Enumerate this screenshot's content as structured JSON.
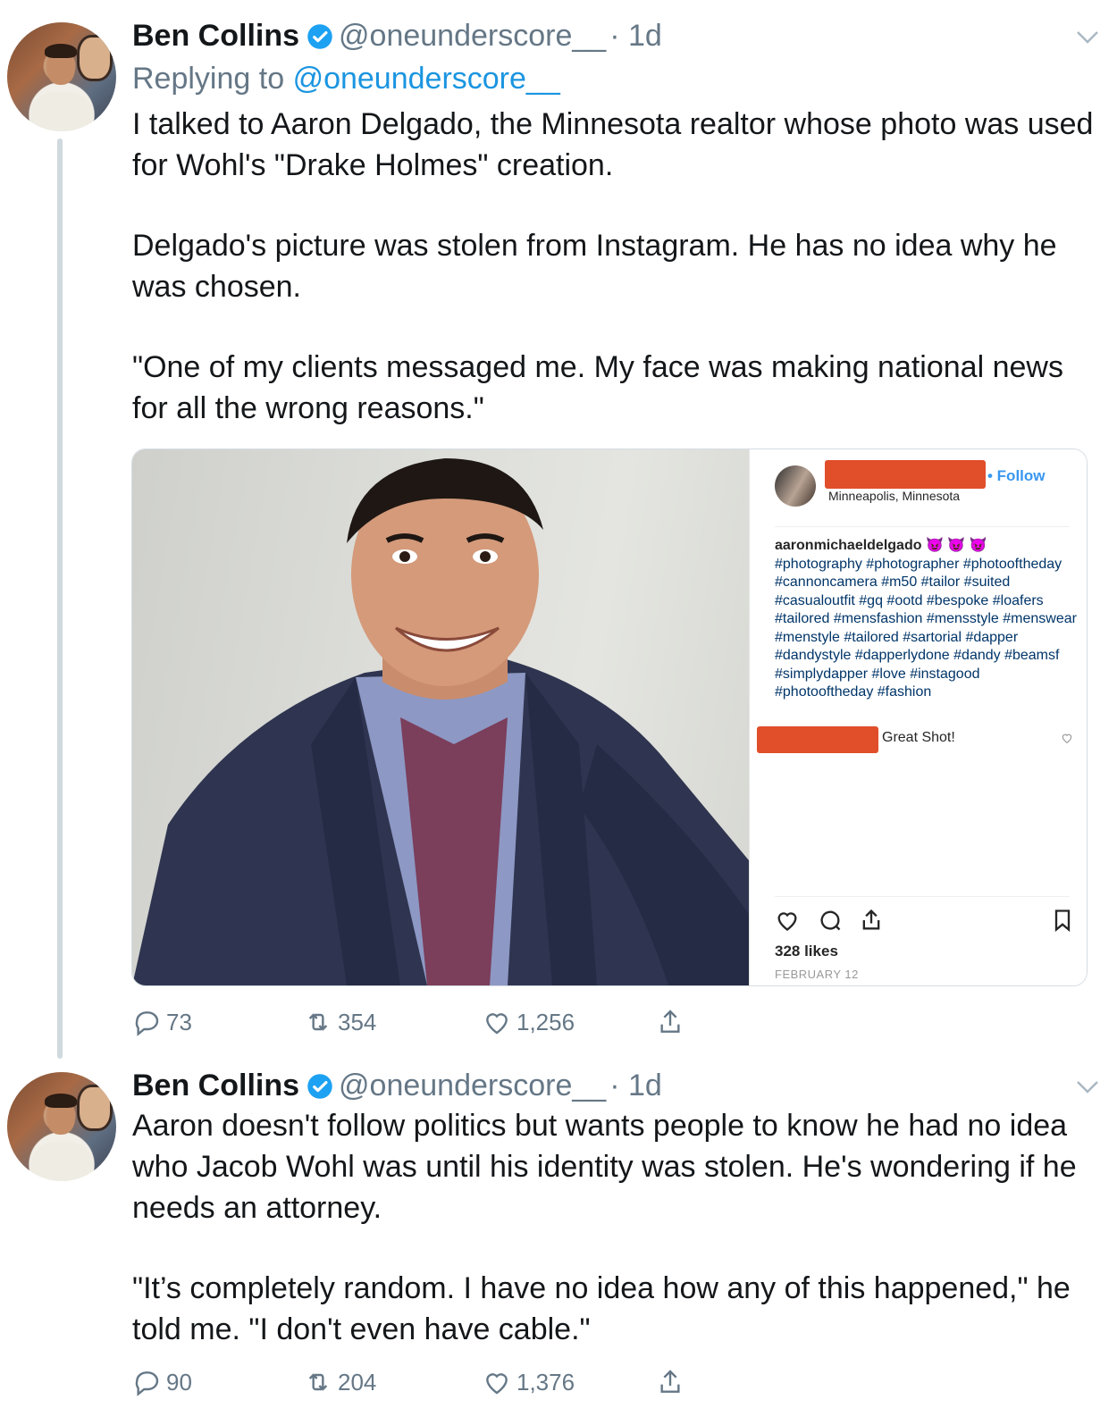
{
  "tweets": [
    {
      "author_name": "Ben Collins",
      "handle": "@oneunderscore__",
      "time": "· 1d",
      "replying_label": "Replying to",
      "replying_handle": "@oneunderscore__",
      "paragraphs": [
        "I talked to Aaron Delgado, the Minnesota realtor whose photo was used for Wohl's \"Drake Holmes\" creation.",
        "Delgado's picture was stolen from Instagram. He has no idea why he was chosen.",
        "\"One of my clients messaged me. My face was making national news for all the wrong reasons.\""
      ],
      "actions": {
        "replies": "73",
        "retweets": "354",
        "likes": "1,256"
      }
    },
    {
      "author_name": "Ben Collins",
      "handle": "@oneunderscore__",
      "time": "· 1d",
      "paragraphs": [
        "Aaron doesn't follow politics but wants people to know he had no idea who Jacob Wohl was until his identity was stolen. He's wondering if he needs an attorney.",
        "\"It’s completely random. I have no idea how any of this happened,\" he told me. \"I don't even have cable.\""
      ],
      "actions": {
        "replies": "90",
        "retweets": "204",
        "likes": "1,376"
      }
    }
  ],
  "instagram": {
    "follow_label": "• Follow",
    "location": "Minneapolis, Minnesota",
    "caption_user": "aaronmichaeldelgado",
    "caption_emoji": "😈 😈 😈",
    "caption_tags": "#photography #photographer #photooftheday #cannoncamera #m50 #tailor #suited #casualoutfit #gq #ootd #bespoke #loafers #tailored #mensfashion #mensstyle #menswear #menstyle #tailored #sartorial #dapper #dandystyle #dapperlydone #dandy #beamsf #simplydapper #love #instagood #photooftheday #fashion",
    "comment": "Great Shot!",
    "likes": "328 likes",
    "date": "FEBRUARY 12"
  },
  "colors": {
    "verified_blue": "#1da1f2",
    "link_blue": "#1b95e0",
    "muted_gray": "#657786",
    "redaction": "#e04e2a",
    "ig_follow": "#3897f0"
  },
  "icons": [
    "verified-badge-icon",
    "chevron-down-icon",
    "reply-icon",
    "retweet-icon",
    "like-icon",
    "share-icon",
    "ig-heart-icon",
    "ig-comment-icon",
    "ig-share-icon",
    "ig-bookmark-icon"
  ]
}
